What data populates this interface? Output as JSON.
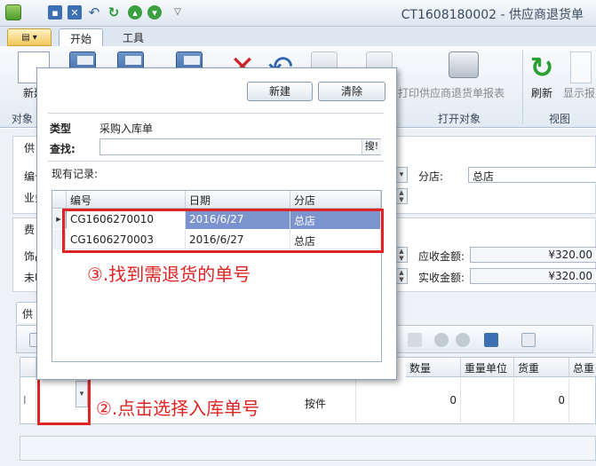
{
  "window": {
    "title": "CT1608180002 - 供应商退货单"
  },
  "tabs": {
    "start": "开始",
    "tools": "工具"
  },
  "ribbon": {
    "new_label": "新建",
    "print_label": "打印供应商退货单报表",
    "refresh_label": "刷新",
    "display_label": "显示报",
    "groups": {
      "object": "对象管",
      "open_object": "打开对象",
      "view": "视图"
    }
  },
  "form": {
    "supplier_tab": "供",
    "code_label": "编号",
    "business_label": "业务",
    "branch_label": "分店:",
    "branch_value": "总店",
    "fee_tab": "费",
    "decorate_label": "饰品",
    "unpaid_label": "未收",
    "receivable_label": "应收金额:",
    "receivable_value": "¥320.00",
    "received_label": "实收金额:",
    "received_value": "¥320.00",
    "detail_tab": "供应"
  },
  "detail_grid": {
    "columns": [
      "数量",
      "重量单位",
      "货重",
      "总重"
    ],
    "row": {
      "unit": "按件",
      "qty": "0",
      "weight": "0"
    }
  },
  "popup": {
    "new_button": "新建",
    "clear_button": "清除",
    "type_label": "类型",
    "type_value": "采购入库单",
    "search_label": "查找:",
    "search_placeholder": "",
    "search_button": "搜!",
    "existing_label": "现有记录:",
    "columns": {
      "code": "编号",
      "date": "日期",
      "branch": "分店"
    },
    "rows": [
      {
        "code": "CG1606270010",
        "date": "2016/6/27",
        "branch": "总店",
        "selected": true
      },
      {
        "code": "CG1606270003",
        "date": "2016/6/27",
        "branch": "总店",
        "selected": false
      }
    ]
  },
  "annotations": {
    "step2": "②.点击选择入库单号",
    "step3": "③.找到需退货的单号",
    "color": "#e02424"
  }
}
